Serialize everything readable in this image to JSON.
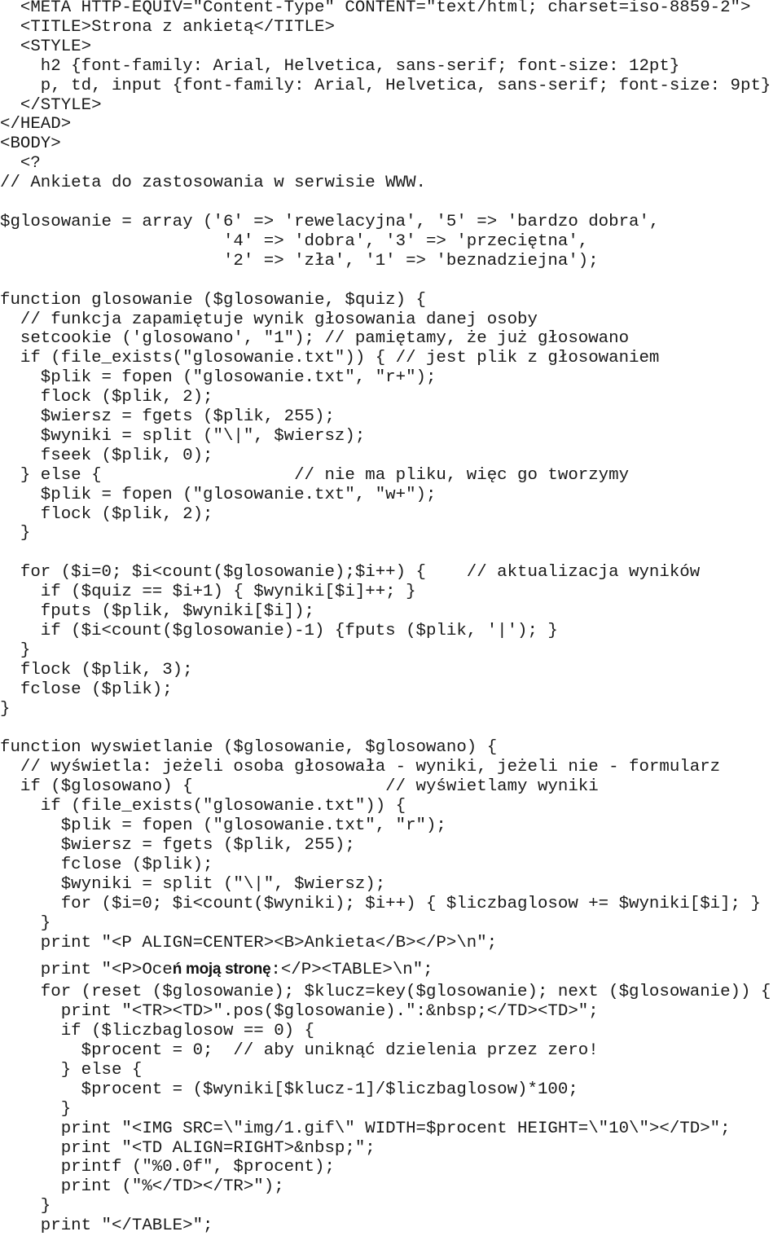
{
  "document": {
    "type": "code-listing",
    "language": "PHP/HTML"
  },
  "code": {
    "lines": [
      "  <META HTTP-EQUIV=\"Content-Type\" CONTENT=\"text/html; charset=iso-8859-2\">",
      "  <TITLE>Strona z ankietą</TITLE>",
      "  <STYLE>",
      "    h2 {font-family: Arial, Helvetica, sans-serif; font-size: 12pt}",
      "    p, td, input {font-family: Arial, Helvetica, sans-serif; font-size: 9pt}",
      "  </STYLE>",
      "</HEAD>",
      "<BODY>",
      "  <?",
      "// Ankieta do zastosowania w serwisie WWW.",
      "",
      "$glosowanie = array ('6' => 'rewelacyjna', '5' => 'bardzo dobra',",
      "                      '4' => 'dobra', '3' => 'przeciętna',",
      "                      '2' => 'zła', '1' => 'beznadziejna');",
      "",
      "function glosowanie ($glosowanie, $quiz) {",
      "  // funkcja zapamiętuje wynik głosowania danej osoby",
      "  setcookie ('glosowano', \"1\"); // pamiętamy, że już głosowano",
      "  if (file_exists(\"glosowanie.txt\")) { // jest plik z głosowaniem",
      "    $plik = fopen (\"glosowanie.txt\", \"r+\");",
      "    flock ($plik, 2);",
      "    $wiersz = fgets ($plik, 255);",
      "    $wyniki = split (\"\\|\", $wiersz);",
      "    fseek ($plik, 0);",
      "  } else {                   // nie ma pliku, więc go tworzymy",
      "    $plik = fopen (\"glosowanie.txt\", \"w+\");",
      "    flock ($plik, 2);",
      "  }",
      "",
      "  for ($i=0; $i<count($glosowanie);$i++) {    // aktualizacja wyników",
      "    if ($quiz == $i+1) { $wyniki[$i]++; }",
      "    fputs ($plik, $wyniki[$i]);",
      "    if ($i<count($glosowanie)-1) {fputs ($plik, '|'); }",
      "  }",
      "  flock ($plik, 3);",
      "  fclose ($plik);",
      "}",
      "",
      "function wyswietlanie ($glosowanie, $glosowano) {",
      "  // wyświetla: jeżeli osoba głosowała - wyniki, jeżeli nie - formularz",
      "  if ($glosowano) {                   // wyświetlamy wyniki",
      "    if (file_exists(\"glosowanie.txt\")) {",
      "      $plik = fopen (\"glosowanie.txt\", \"r\");",
      "      $wiersz = fgets ($plik, 255);",
      "      fclose ($plik);",
      "      $wyniki = split (\"\\|\", $wiersz);",
      "      for ($i=0; $i<count($wyniki); $i++) { $liczbaglosow += $wyniki[$i]; }",
      "    }",
      "    print \"<P ALIGN=CENTER><B>Ankieta</B></P>\\n\";",
      {
        "segments": [
          {
            "text": "    print \"<P>Oce",
            "style": "mono"
          },
          {
            "text": "ń moj",
            "style": "sans"
          },
          {
            "text": "ą stron",
            "style": "sans"
          },
          {
            "text": "ę",
            "style": "sans"
          },
          {
            "text": ":</P><TABLE>\\n\";",
            "style": "mono"
          }
        ]
      },
      "    for (reset ($glosowanie); $klucz=key($glosowanie); next ($glosowanie)) {",
      "      print \"<TR><TD>\".pos($glosowanie).\":&nbsp;</TD><TD>\";",
      "      if ($liczbaglosow == 0) {",
      "        $procent = 0;  // aby uniknąć dzielenia przez zero!",
      "      } else {",
      "        $procent = ($wyniki[$klucz-1]/$liczbaglosow)*100;",
      "      }",
      "      print \"<IMG SRC=\\\"img/1.gif\\\" WIDTH=$procent HEIGHT=\\\"10\\\"></TD>\";",
      "      print \"<TD ALIGN=RIGHT>&nbsp;\";",
      "      printf (\"%0.0f\", $procent);",
      "      print (\"%</TD></TR>\");",
      "    }",
      "    print \"</TABLE>\";"
    ]
  }
}
